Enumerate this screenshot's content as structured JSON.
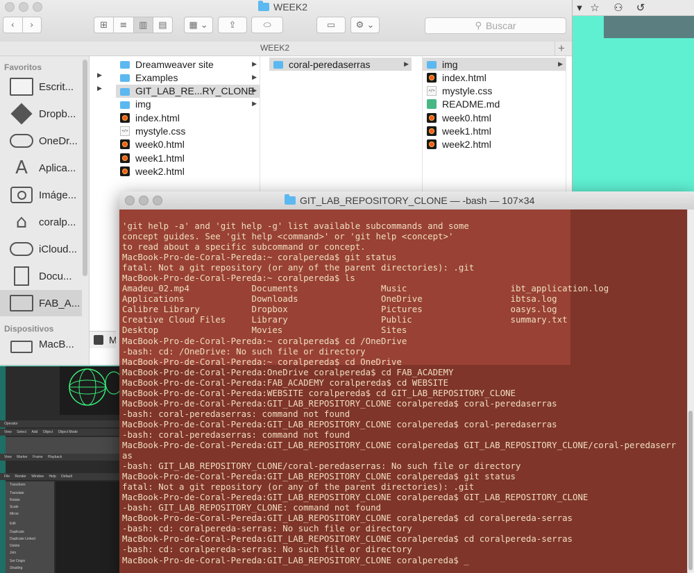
{
  "finder": {
    "title": "WEEK2",
    "path_title": "WEEK2",
    "search_placeholder": "Buscar",
    "sidebar": {
      "favorites_heading": "Favoritos",
      "devices_heading": "Dispositivos",
      "items": [
        {
          "label": "Escrit...",
          "icon": "desktop-icon"
        },
        {
          "label": "Dropb...",
          "icon": "dropbox-icon"
        },
        {
          "label": "OneDr...",
          "icon": "cloud-icon"
        },
        {
          "label": "Aplica...",
          "icon": "applications-icon"
        },
        {
          "label": "Imáge...",
          "icon": "camera-icon"
        },
        {
          "label": "coralp...",
          "icon": "home-icon"
        },
        {
          "label": "iCloud...",
          "icon": "icloud-icon"
        },
        {
          "label": "Docu...",
          "icon": "document-icon"
        },
        {
          "label": "FAB_A...",
          "icon": "folder-icon"
        }
      ],
      "device_label": "MacB..."
    },
    "column1": [
      {
        "name": "Dreamweaver site",
        "type": "folder",
        "arrow": true
      },
      {
        "name": "Examples",
        "type": "folder",
        "arrow": true
      },
      {
        "name": "GIT_LAB_RE...RY_CLONE",
        "type": "folder",
        "arrow": true,
        "selected": true
      },
      {
        "name": "img",
        "type": "folder",
        "arrow": true
      },
      {
        "name": "index.html",
        "type": "html"
      },
      {
        "name": "mystyle.css",
        "type": "css"
      },
      {
        "name": "week0.html",
        "type": "html"
      },
      {
        "name": "week1.html",
        "type": "html"
      },
      {
        "name": "week2.html",
        "type": "html"
      }
    ],
    "column2": [
      {
        "name": "coral-peredaserras",
        "type": "folder",
        "arrow": true,
        "selected": true
      }
    ],
    "column3": [
      {
        "name": "img",
        "type": "folder",
        "arrow": true,
        "selected": true
      },
      {
        "name": "index.html",
        "type": "html"
      },
      {
        "name": "mystyle.css",
        "type": "css"
      },
      {
        "name": "README.md",
        "type": "md"
      },
      {
        "name": "week0.html",
        "type": "html"
      },
      {
        "name": "week1.html",
        "type": "html"
      },
      {
        "name": "week2.html",
        "type": "html"
      }
    ],
    "bottom_partial_label": "M"
  },
  "terminal": {
    "title": "GIT_LAB_REPOSITORY_CLONE — -bash — 107×34",
    "lines": [
      "'git help -a' and 'git help -g' list available subcommands and some",
      "concept guides. See 'git help <command>' or 'git help <concept>'",
      "to read about a specific subcommand or concept.",
      "MacBook-Pro-de-Coral-Pereda:~ coralpereda$ git status",
      "fatal: Not a git repository (or any of the parent directories): .git",
      "MacBook-Pro-de-Coral-Pereda:~ coralpereda$ ls",
      "Amadeu_02.mp4            Documents                Music                    ibt_application.log",
      "Applications             Downloads                OneDrive                 ibtsa.log",
      "Calibre Library          Dropbox                  Pictures                 oasys.log",
      "Creative Cloud Files     Library                  Public                   summary.txt",
      "Desktop                  Movies                   Sites",
      "MacBook-Pro-de-Coral-Pereda:~ coralpereda$ cd /OneDrive",
      "-bash: cd: /OneDrive: No such file or directory",
      "MacBook-Pro-de-Coral-Pereda:~ coralpereda$ cd OneDrive",
      "MacBook-Pro-de-Coral-Pereda:OneDrive coralpereda$ cd FAB_ACADEMY",
      "MacBook-Pro-de-Coral-Pereda:FAB_ACADEMY coralpereda$ cd WEBSITE",
      "MacBook-Pro-de-Coral-Pereda:WEBSITE coralpereda$ cd GIT_LAB_REPOSITORY_CLONE",
      "MacBook-Pro-de-Coral-Pereda:GIT_LAB_REPOSITORY_CLONE coralpereda$ coral-peredaserras",
      "-bash: coral-peredaserras: command not found",
      "MacBook-Pro-de-Coral-Pereda:GIT_LAB_REPOSITORY_CLONE coralpereda$ coral-peredaserras",
      "-bash: coral-peredaserras: command not found",
      "MacBook-Pro-de-Coral-Pereda:GIT_LAB_REPOSITORY_CLONE coralpereda$ GIT_LAB_REPOSITORY_CLONE/coral-peredaserr",
      "as",
      "-bash: GIT_LAB_REPOSITORY_CLONE/coral-peredaserras: No such file or directory",
      "MacBook-Pro-de-Coral-Pereda:GIT_LAB_REPOSITORY_CLONE coralpereda$ git status",
      "fatal: Not a git repository (or any of the parent directories): .git",
      "MacBook-Pro-de-Coral-Pereda:GIT_LAB_REPOSITORY_CLONE coralpereda$ GIT_LAB_REPOSITORY_CLONE",
      "-bash: GIT_LAB_REPOSITORY_CLONE: command not found",
      "MacBook-Pro-de-Coral-Pereda:GIT_LAB_REPOSITORY_CLONE coralpereda$ cd coralpereda-serras",
      "-bash: cd: coralpereda-serras: No such file or directory",
      "MacBook-Pro-de-Coral-Pereda:GIT_LAB_REPOSITORY_CLONE coralpereda$ cd coralpereda-serras",
      "-bash: cd: coralpereda-serras: No such file or directory",
      "MacBook-Pro-de-Coral-Pereda:GIT_LAB_REPOSITORY_CLONE coralpereda$ _"
    ]
  },
  "background_app": {
    "labels": [
      "Operator",
      "View",
      "Select",
      "Add",
      "Object",
      "Object Mode",
      "View",
      "Marker",
      "Frame",
      "Playback",
      "File",
      "Render",
      "Window",
      "Help",
      "Default",
      "Transform",
      "Translate",
      "Rotate",
      "Scale",
      "Mirror",
      "Edit",
      "Duplicate",
      "Duplicate Linked",
      "Delete",
      "Join",
      "Set Origin",
      "Shading"
    ]
  },
  "colors": {
    "terminal_bg": "#7f3529",
    "terminal_text": "#f0ddc0",
    "desktop_bg": "#5fe8cf",
    "folder_blue": "#5cb8f0"
  }
}
